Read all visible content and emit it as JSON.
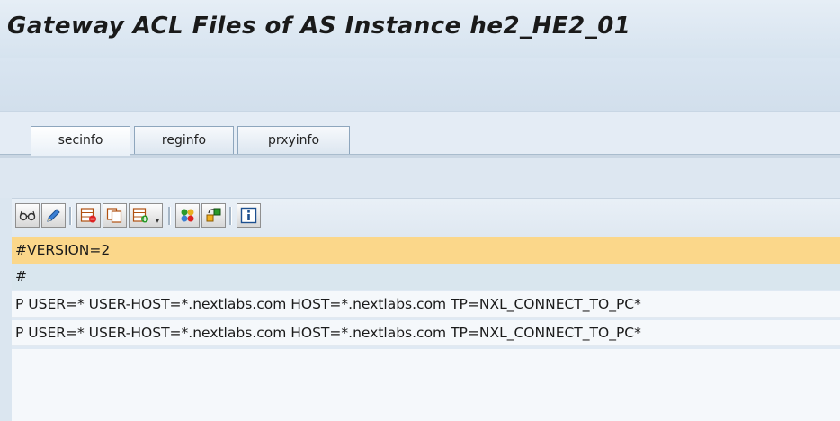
{
  "window": {
    "title": "Gateway ACL Files of AS Instance he2_HE2_01"
  },
  "tabs": [
    {
      "label": "secinfo",
      "active": true
    },
    {
      "label": "reginfo",
      "active": false
    },
    {
      "label": "prxyinfo",
      "active": false
    }
  ],
  "toolbar": {
    "buttons": [
      {
        "icon": "glasses-icon",
        "name": "display-button"
      },
      {
        "icon": "pencil-icon",
        "name": "change-button"
      },
      {
        "icon": "delete-row-icon",
        "name": "delete-row-button"
      },
      {
        "icon": "copy-row-icon",
        "name": "copy-row-button"
      },
      {
        "icon": "insert-row-icon",
        "name": "insert-row-button"
      },
      {
        "icon": "color-cycle-icon",
        "name": "reload-button"
      },
      {
        "icon": "activate-icon",
        "name": "activate-button"
      },
      {
        "icon": "info-icon",
        "name": "info-button"
      }
    ]
  },
  "lines": [
    "#VERSION=2",
    "#",
    "P USER=* USER-HOST=*.nextlabs.com HOST=*.nextlabs.com TP=NXL_CONNECT_TO_PC*",
    "P USER=* USER-HOST=*.nextlabs.com HOST=*.nextlabs.com TP=NXL_CONNECT_TO_PC*"
  ],
  "colors": {
    "selected_row": "#fbd78a",
    "cursor_row": "#d9e6ee",
    "background": "#dfe9f3"
  }
}
